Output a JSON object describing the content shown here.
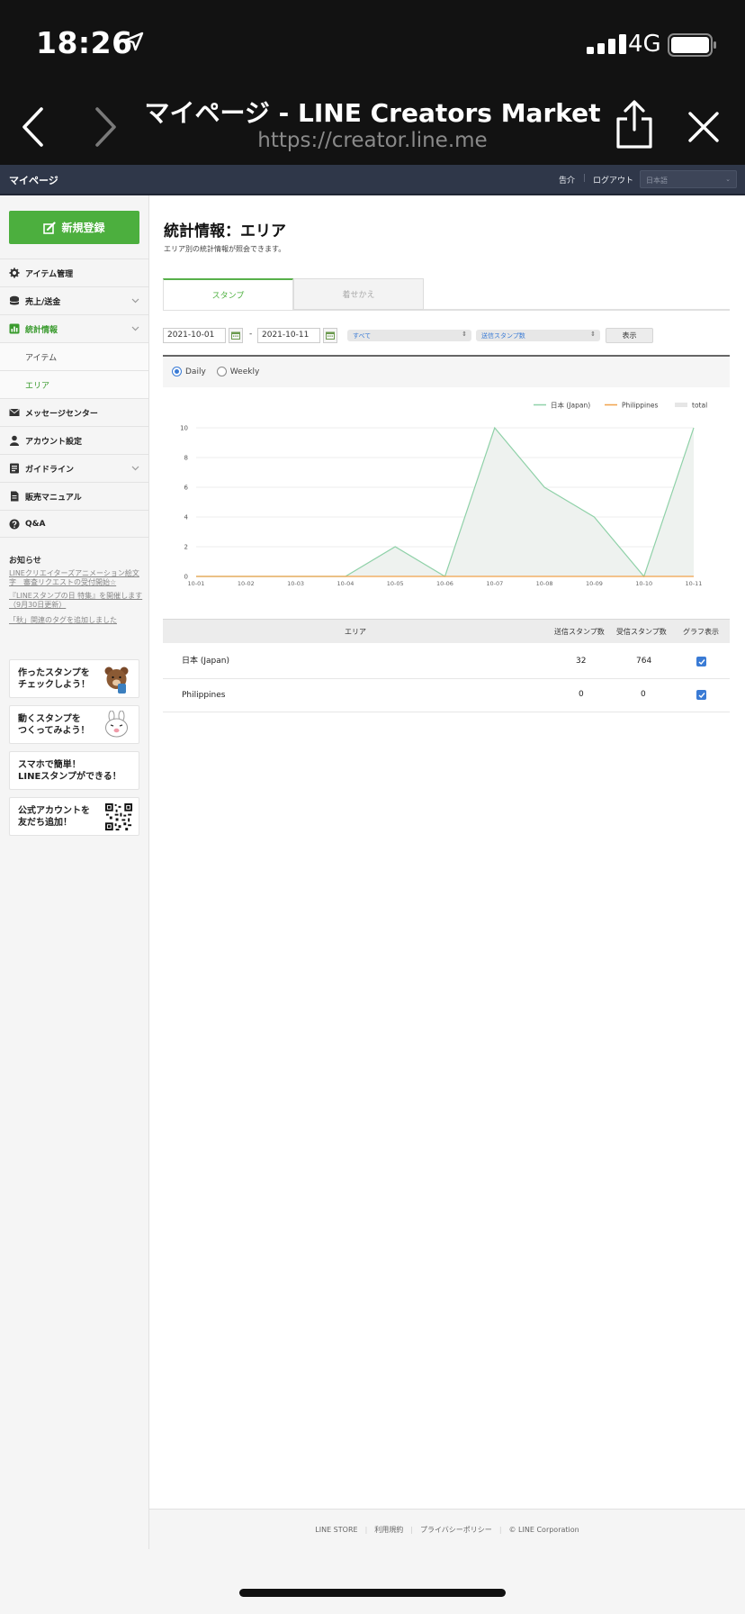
{
  "status": {
    "time": "18:26",
    "network": "4G"
  },
  "browser": {
    "title": "マイページ - LINE Creators Market",
    "url": "https://creator.line.me"
  },
  "header": {
    "title": "マイページ",
    "links": [
      "告介",
      "ログアウト"
    ],
    "language": "日本語"
  },
  "sidebar": {
    "new_button": "新規登録",
    "items": [
      {
        "label": "アイテム管理",
        "icon": "gear-icon"
      },
      {
        "label": "売上/送金",
        "icon": "coins-icon"
      },
      {
        "label": "統計情報",
        "icon": "chart-icon"
      },
      {
        "label": "メッセージセンター",
        "icon": "mail-icon"
      },
      {
        "label": "アカウント設定",
        "icon": "user-icon"
      },
      {
        "label": "ガイドライン",
        "icon": "book-icon"
      },
      {
        "label": "販売マニュアル",
        "icon": "document-icon"
      },
      {
        "label": "Q&A",
        "icon": "question-icon"
      }
    ],
    "sub_items": [
      "アイテム",
      "エリア"
    ],
    "notice_heading": "お知らせ",
    "notices": [
      "LINEクリエイターズアニメーション絵文字　審査リクエストの受付開始☆",
      "『LINEスタンプの日 特集』を開催します（9月30日更新）",
      "「秋」関連のタグを追加しました"
    ],
    "promos": [
      {
        "line1": "作ったスタンプを",
        "line2": "チェックしよう！"
      },
      {
        "line1": "動くスタンプを",
        "line2": "つくってみよう！"
      },
      {
        "line1": "スマホで簡単！",
        "line2": "LINEスタンプができる！"
      },
      {
        "line1": "公式アカウントを",
        "line2": "友だち追加！"
      }
    ]
  },
  "main": {
    "title": "統計情報：エリア",
    "description": "エリア別の統計情報が照会できます。",
    "tabs": [
      "スタンプ",
      "着せかえ"
    ],
    "filters": {
      "start_date": "2021-10-01",
      "end_date": "2021-10-11",
      "range_sep": "-",
      "select1": "すべて",
      "select2": "送信スタンプ数",
      "show_button": "表示"
    },
    "radios": [
      "Daily",
      "Weekly"
    ],
    "table": {
      "headers": [
        "エリア",
        "送信スタンプ数",
        "受信スタンプ数",
        "グラフ表示"
      ],
      "rows": [
        {
          "area": "日本 (Japan)",
          "sent": "32",
          "received": "764"
        },
        {
          "area": "Philippines",
          "sent": "0",
          "received": "0"
        }
      ]
    }
  },
  "chart_data": {
    "type": "line",
    "categories": [
      "10-01",
      "10-02",
      "10-03",
      "10-04",
      "10-05",
      "10-06",
      "10-07",
      "10-08",
      "10-09",
      "10-10",
      "10-11"
    ],
    "series": [
      {
        "name": "日本 (Japan)",
        "values": [
          0,
          0,
          0,
          0,
          2,
          0,
          10,
          6,
          4,
          0,
          10
        ],
        "color": "#8fd1a8"
      },
      {
        "name": "Philippines",
        "values": [
          0,
          0,
          0,
          0,
          0,
          0,
          0,
          0,
          0,
          0,
          0
        ],
        "color": "#f0a24b"
      },
      {
        "name": "total",
        "values": [
          0,
          0,
          0,
          0,
          2,
          0,
          10,
          6,
          4,
          0,
          10
        ],
        "color": "#e6e6e6"
      }
    ],
    "y_ticks": [
      0,
      2,
      4,
      6,
      8,
      10
    ],
    "ylim": [
      0,
      10
    ],
    "legend": "top-right",
    "grid": true
  },
  "footer": {
    "links": [
      "LINE STORE",
      "利用規約",
      "プライバシーポリシー",
      "© LINE Corporation"
    ]
  }
}
